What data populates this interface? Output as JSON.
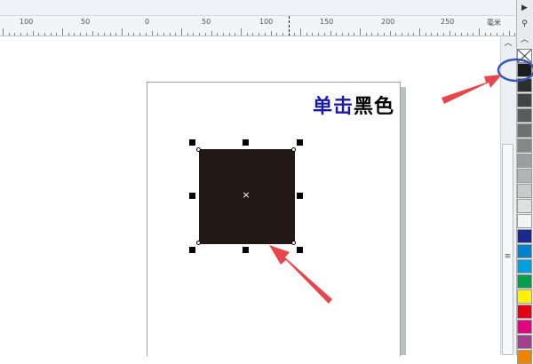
{
  "ruler": {
    "labels": [
      "100",
      "50",
      "0",
      "50",
      "100",
      "150",
      "200",
      "250"
    ],
    "unit": "毫米"
  },
  "canvas": {
    "selected_object": {
      "fill": "#231816",
      "handle_count": 8,
      "center_marker": "×"
    }
  },
  "palette": {
    "top_controls": [
      "▶",
      "⚲",
      "︿"
    ],
    "no_color_icon": "none-swatch-icon",
    "swatches": [
      "#1c1c1c",
      "#2e2e2e",
      "#444444",
      "#5a5a5a",
      "#707070",
      "#878787",
      "#9d9d9d",
      "#b4b4b4",
      "#cacaca",
      "#e0e0e0",
      "#f4f4f4",
      "#1b2a8c",
      "#0083cc",
      "#00a0e0",
      "#00a04a",
      "#fff200",
      "#e60012",
      "#e4007f",
      "#a0418e",
      "#f08300"
    ],
    "grip": "≡"
  },
  "annotation": {
    "caption_blue": "单击",
    "caption_black": "黑色",
    "arrow_color": "#e8464a",
    "circle_color": "#3a55b5"
  }
}
